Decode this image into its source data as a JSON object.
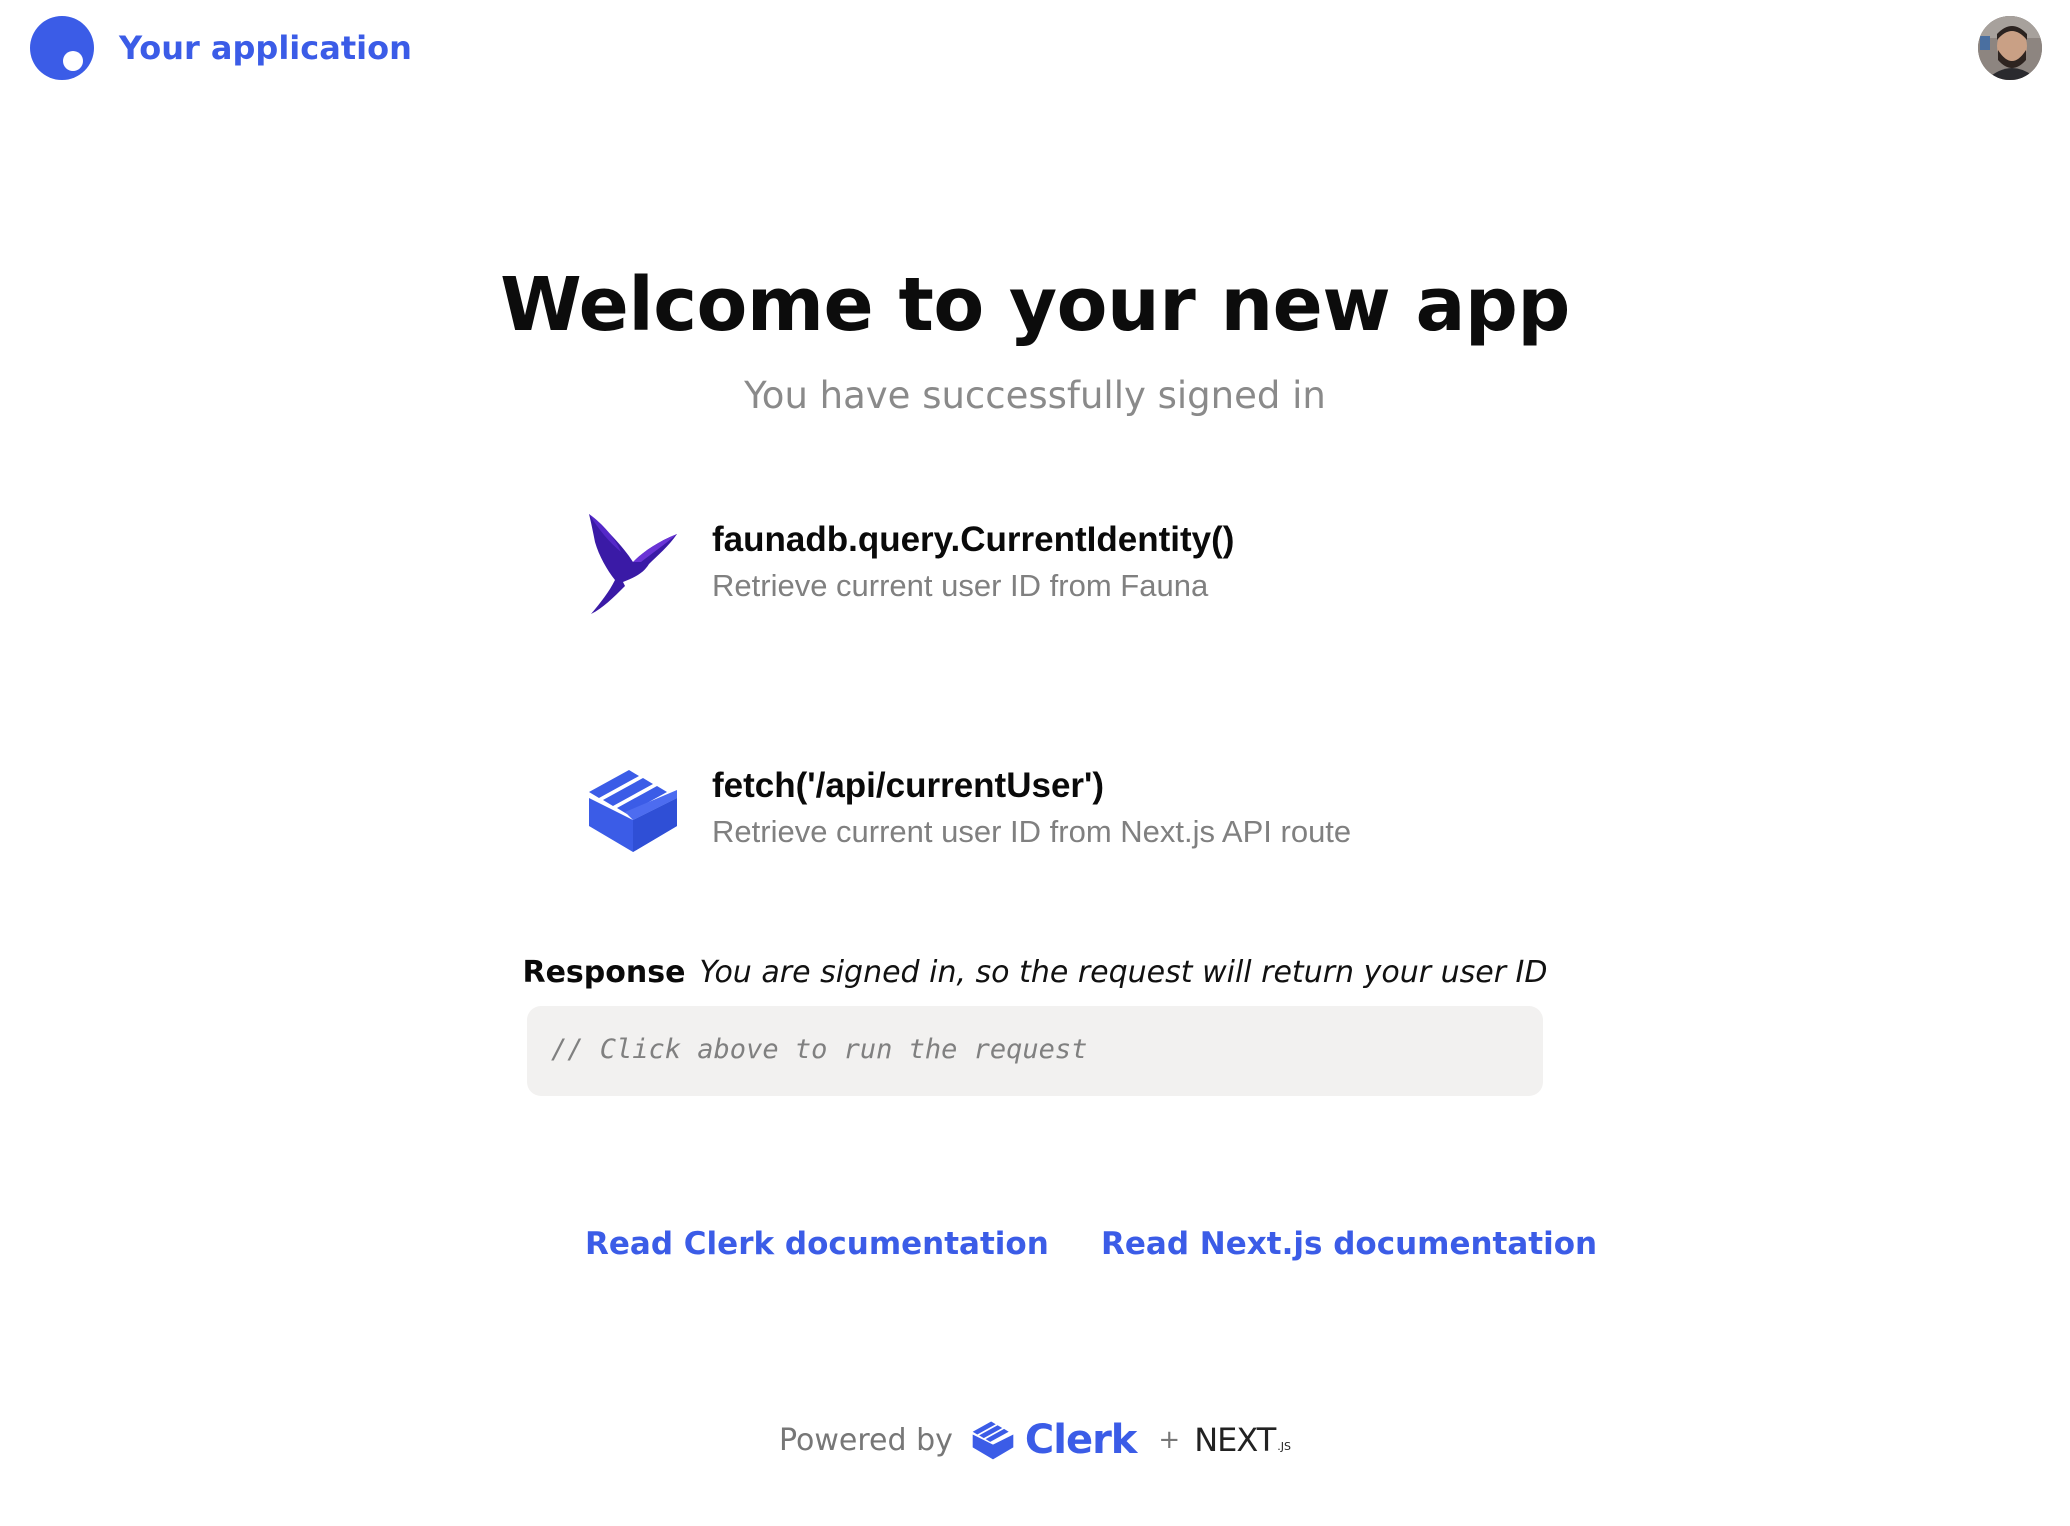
{
  "header": {
    "app_name": "Your application",
    "brand_color": "#3b5ce7"
  },
  "main": {
    "title": "Welcome to your new app",
    "subtitle": "You have successfully signed in",
    "actions": [
      {
        "icon": "fauna-bird-icon",
        "title": "faunadb.query.CurrentIdentity()",
        "description": "Retrieve current user ID from Fauna"
      },
      {
        "icon": "clerk-box-icon",
        "title": "fetch('/api/currentUser')",
        "description": "Retrieve current user ID from Next.js API route"
      }
    ],
    "response": {
      "label": "Response",
      "note": "You are signed in, so the request will return your user ID",
      "code": "// Click above to run the request"
    },
    "links": [
      {
        "label": "Read Clerk documentation"
      },
      {
        "label": "Read Next.js documentation"
      }
    ]
  },
  "footer": {
    "powered_by": "Powered by",
    "clerk": "Clerk",
    "plus": "+",
    "next": "NEXT",
    "next_suffix": ".JS"
  }
}
